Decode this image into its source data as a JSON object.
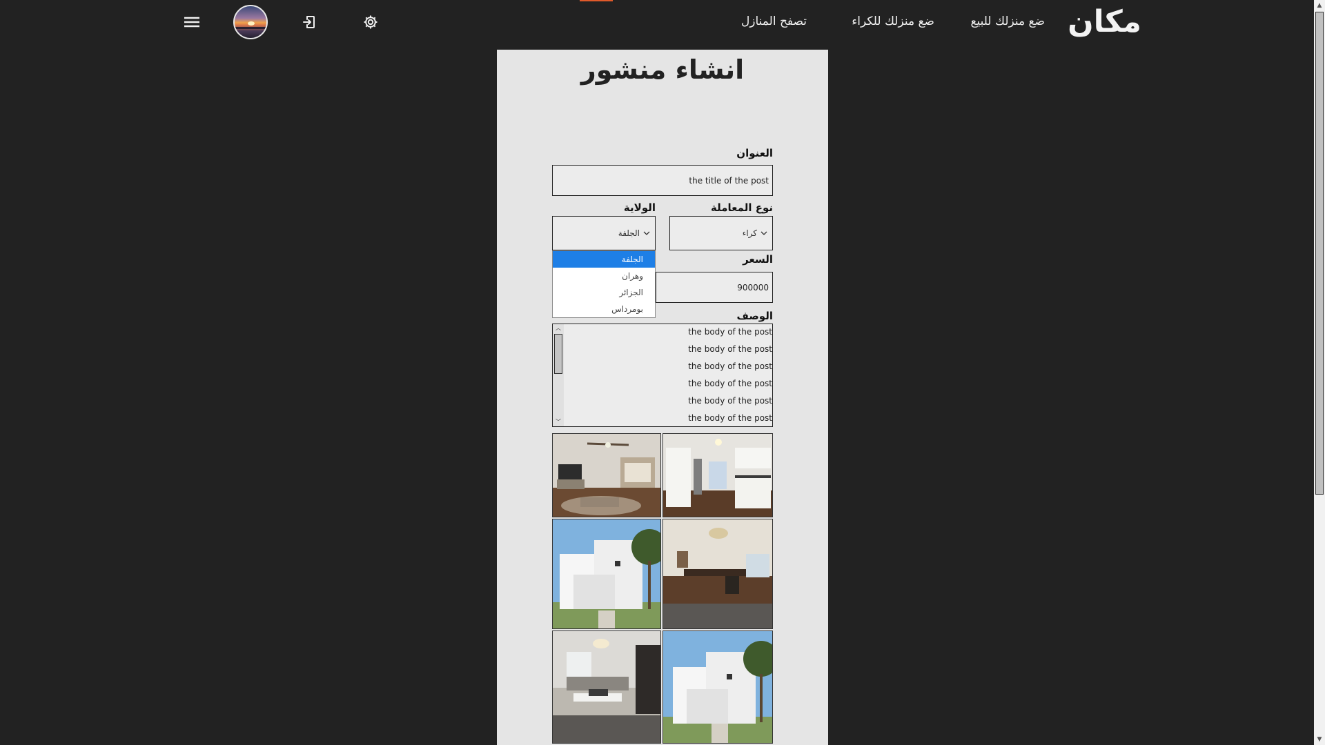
{
  "nav": {
    "logo": "مكان",
    "sell_link": "ضع منزلك للبيع",
    "rent_link": "ضع منزلك للكراء",
    "browse_link": "تصفح المنازل",
    "icons": [
      "settings-gear-icon",
      "logout-icon",
      "user-avatar",
      "hamburger-menu-icon"
    ],
    "accent_color": "#e05a2a"
  },
  "form": {
    "title": "انشاء منشور",
    "title_label": "العنوان",
    "title_value": "the title of the post",
    "transaction_label": "نوع المعاملة",
    "transaction_value": "كراء",
    "state_label": "الولاية",
    "state_value": "الجلفة",
    "state_options": [
      "الجلفة",
      "وهران",
      "الجزائر",
      "بومرداس"
    ],
    "price_label": "السعر",
    "price_value": "900000",
    "description_label": "الوصف",
    "description_lines": [
      "the body of the post",
      "the body of the post",
      "the body of the post",
      "the body of the post",
      "the body of the post",
      "the body of the post"
    ],
    "selected_option_color": "#1e7fe6"
  },
  "gallery": {
    "images": [
      "living-room-photo",
      "kitchen-photo",
      "house-exterior-photo",
      "dining-room-photo",
      "lounge-photo",
      "house-exterior-photo"
    ]
  }
}
